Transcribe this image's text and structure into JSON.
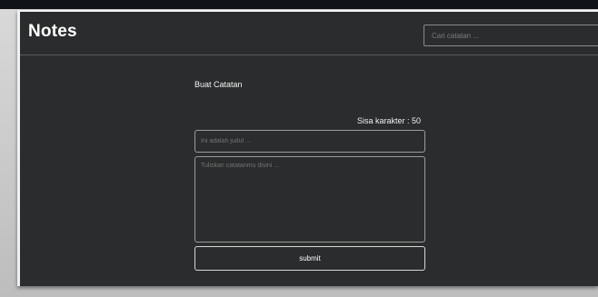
{
  "app": {
    "title": "Notes"
  },
  "search": {
    "placeholder": "Cari catatan ..."
  },
  "form": {
    "heading": "Buat Catatan",
    "remaining_characters": "Sisa karakter : 50",
    "title_placeholder": "Ini adalah judul ...",
    "body_placeholder": "Tuliskan catatanmu disini ...",
    "submit_label": "submit"
  }
}
